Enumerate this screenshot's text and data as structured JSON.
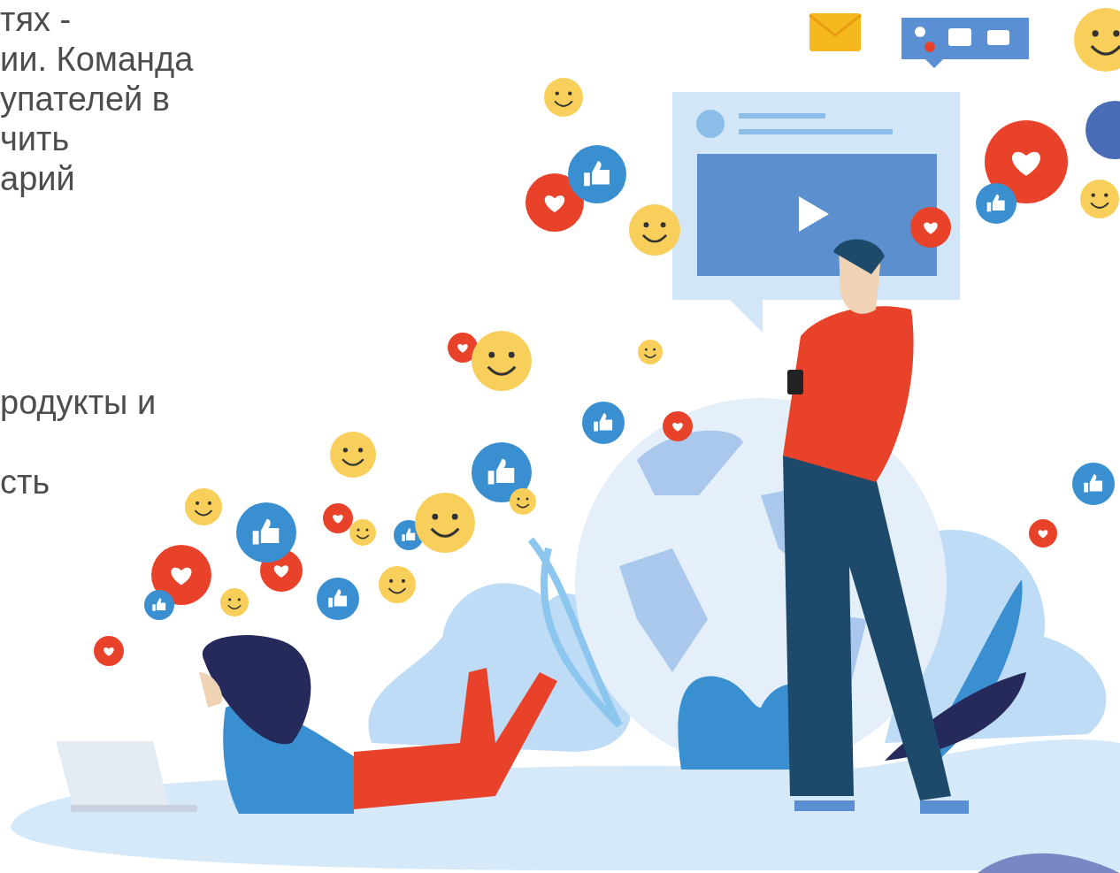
{
  "text_blocks": [
    {
      "lines": [
        "тях -",
        "ии. Команда",
        "упателей в",
        "чить",
        "арий"
      ]
    },
    {
      "lines": [
        "родукты и"
      ]
    },
    {
      "lines": [
        "сть"
      ]
    }
  ]
}
